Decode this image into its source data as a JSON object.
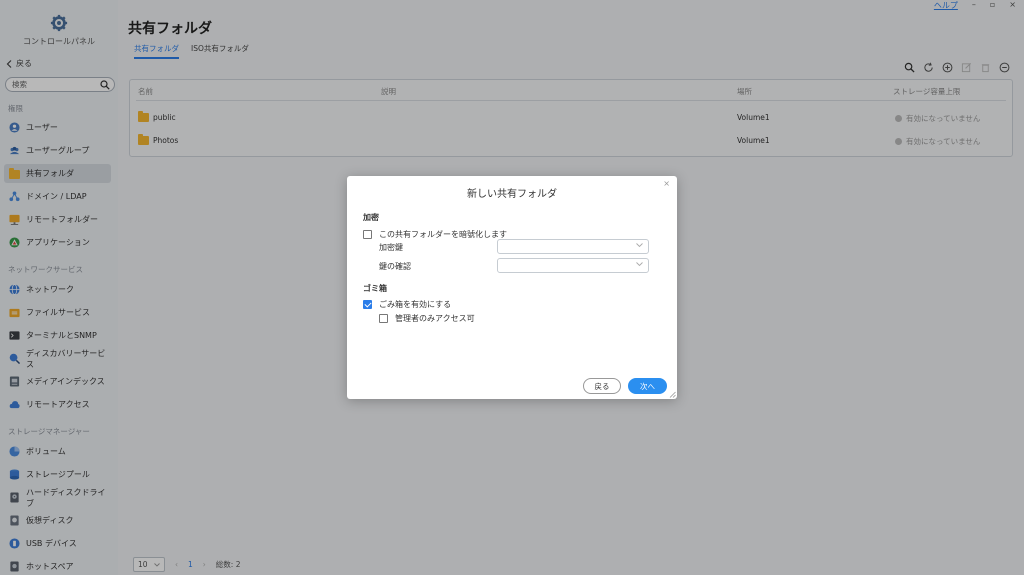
{
  "window": {
    "help_label": "ヘルプ",
    "minimize": "–",
    "maximize": "▫",
    "close": "×"
  },
  "sidebar": {
    "title": "コントロールパネル",
    "back_label": "戻る",
    "search_placeholder": "検索",
    "sections": [
      {
        "label": "権限",
        "items": [
          {
            "label": "ユーザー",
            "icon": "user-icon"
          },
          {
            "label": "ユーザーグループ",
            "icon": "user-group-icon"
          },
          {
            "label": "共有フォルダ",
            "icon": "folder-icon",
            "active": true
          },
          {
            "label": "ドメイン / LDAP",
            "icon": "domain-icon"
          },
          {
            "label": "リモートフォルダー",
            "icon": "remote-folder-icon"
          },
          {
            "label": "アプリケーション",
            "icon": "application-icon"
          }
        ]
      },
      {
        "label": "ネットワークサービス",
        "items": [
          {
            "label": "ネットワーク",
            "icon": "network-icon"
          },
          {
            "label": "ファイルサービス",
            "icon": "file-service-icon"
          },
          {
            "label": "ターミナルとSNMP",
            "icon": "terminal-icon"
          },
          {
            "label": "ディスカバリーサービス",
            "icon": "discovery-icon"
          },
          {
            "label": "メディアインデックス",
            "icon": "media-index-icon"
          },
          {
            "label": "リモートアクセス",
            "icon": "remote-access-icon"
          }
        ]
      },
      {
        "label": "ストレージマネージャー",
        "items": [
          {
            "label": "ボリューム",
            "icon": "volume-icon"
          },
          {
            "label": "ストレージプール",
            "icon": "storage-pool-icon"
          },
          {
            "label": "ハードディスクドライブ",
            "icon": "hdd-icon"
          },
          {
            "label": "仮想ディスク",
            "icon": "virtual-disk-icon"
          },
          {
            "label": "USB デバイス",
            "icon": "usb-icon"
          },
          {
            "label": "ホットスペア",
            "icon": "hot-spare-icon"
          }
        ]
      }
    ]
  },
  "main": {
    "title": "共有フォルダ",
    "tabs": [
      {
        "label": "共有フォルダ",
        "active": true
      },
      {
        "label": "ISO共有フォルダ"
      }
    ],
    "columns": [
      "名前",
      "説明",
      "場所",
      "ストレージ容量上限"
    ],
    "rows": [
      {
        "name": "public",
        "description": "",
        "location": "Volume1",
        "quota": "有効になっていません"
      },
      {
        "name": "Photos",
        "description": "",
        "location": "Volume1",
        "quota": "有効になっていません"
      }
    ],
    "pager": {
      "page_size": "10",
      "current_page": "1",
      "total": "総数: 2"
    }
  },
  "dialog": {
    "title": "新しい共有フォルダ",
    "encryption": {
      "section_label": "加密",
      "checkbox_label": "この共有フォルダーを暗號化します",
      "checked": false,
      "key_label": "加密鍵",
      "key_value": "",
      "confirm_label": "鍵の確認",
      "confirm_value": ""
    },
    "recycle": {
      "section_label": "ゴミ箱",
      "enable_label": "ごみ箱を有効にする",
      "enable_checked": true,
      "admin_label": "管理者のみアクセス可",
      "admin_checked": false
    },
    "back_button": "戻る",
    "next_button": "次へ"
  },
  "colors": {
    "accent": "#2b7de9",
    "folder": "#f5b731",
    "active_nav": "#d6dbe1"
  }
}
